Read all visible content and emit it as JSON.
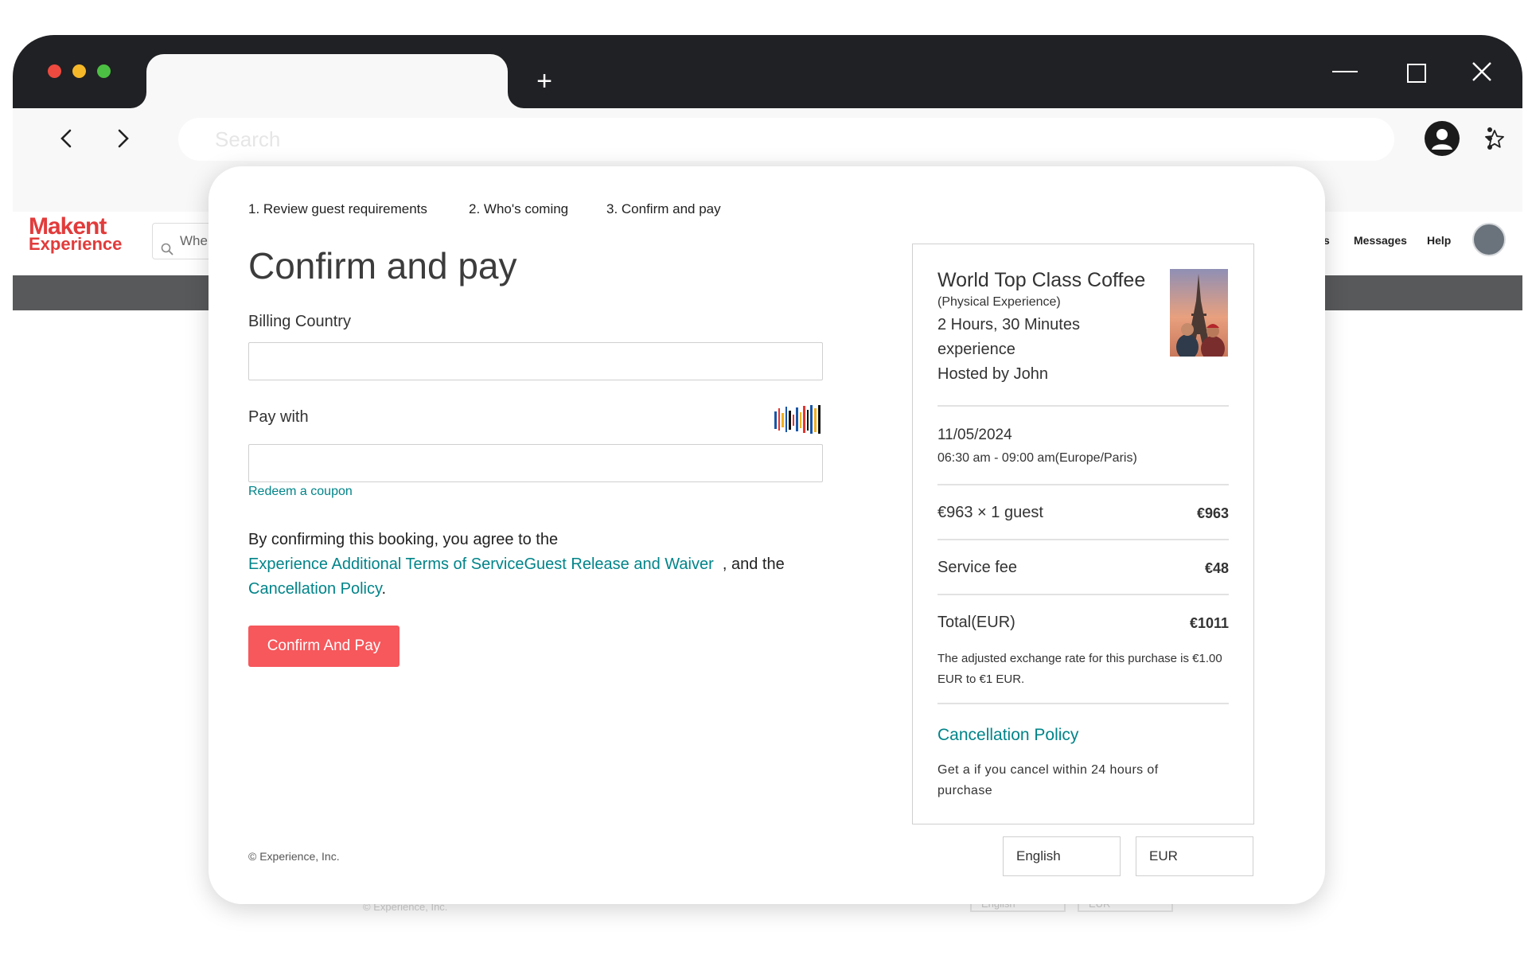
{
  "browser": {
    "search_placeholder": "Search",
    "newtab_symbol": "+"
  },
  "site": {
    "logo_line1": "Makent",
    "logo_line2": "Experience",
    "search_text": "Whe",
    "nav": {
      "partial": "s",
      "messages": "Messages",
      "help": "Help"
    },
    "ghost_footer": "© Experience, Inc.",
    "ghost_english": "English",
    "ghost_eur": "EUR"
  },
  "steps": {
    "step1": "1. Review guest requirements",
    "step2": "2. Who's coming",
    "step3": "3. Confirm and pay"
  },
  "form": {
    "title": "Confirm and pay",
    "billing_label": "Billing Country",
    "billing_value": "",
    "pay_label": "Pay with",
    "pay_value": "",
    "coupon_link": "Redeem a coupon",
    "agree_prefix": "By confirming this booking, you agree to the",
    "terms_link": "Experience Additional Terms of Service",
    "waiver_link": "Guest Release and Waiver",
    "agree_mid": ", and the",
    "cancellation_link": "Cancellation Policy",
    "agree_suffix": ".",
    "confirm_button": "Confirm And Pay"
  },
  "summary": {
    "title": "World Top Class Coffee",
    "subtitle": "(Physical Experience)",
    "duration_line1": "2 Hours, 30 Minutes",
    "duration_line2": "experience",
    "host": "Hosted by John",
    "date": "11/05/2024",
    "time": "06:30 am - 09:00 am(Europe/Paris)",
    "price_label": "€963 × 1 guest",
    "price_value": "€963",
    "fee_label": "Service fee",
    "fee_value": "€48",
    "total_label": "Total(EUR)",
    "total_value": "€1011",
    "exchange_note": "The adjusted exchange rate for this purchase is €1.00 EUR to €1 EUR.",
    "cancel_title": "Cancellation Policy",
    "cancel_text": "Get a  if you cancel within 24 hours of purchase"
  },
  "footer": {
    "copyright": "© Experience, Inc.",
    "language": "English",
    "currency": "EUR"
  },
  "colors": {
    "accent_teal": "#008489",
    "button_red": "#f6585c",
    "logo_red": "#e23b3b",
    "chrome_dark": "#202124"
  }
}
